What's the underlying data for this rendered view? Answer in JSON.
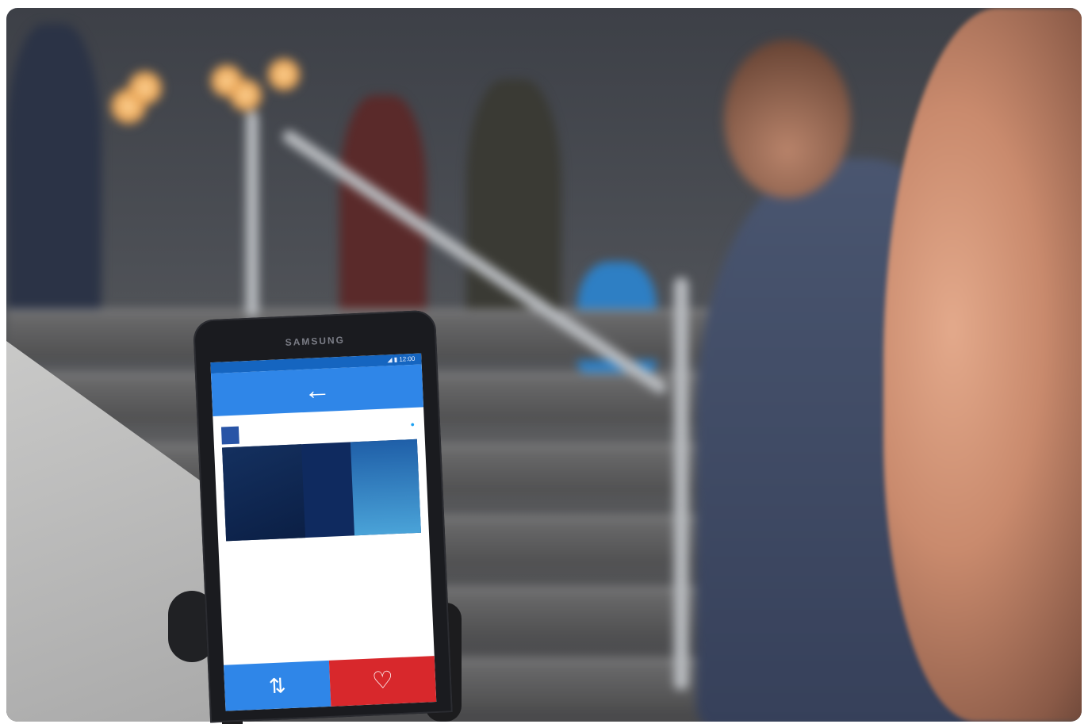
{
  "phone": {
    "brand": "SAMSUNG",
    "status_time": "◢ ▮ 12:00"
  },
  "app": {
    "back_icon": "back-arrow-icon",
    "accent_color": "#2f86e8",
    "like_color": "#d8282c"
  },
  "tweet": {
    "avatar_text": "",
    "handle": "",
    "handle_meta": "",
    "card_left_text": "",
    "card_right_title": "",
    "body_text": ""
  },
  "actions": {
    "retweet_icon": "retweet-icon",
    "like_icon": "heart-icon"
  }
}
